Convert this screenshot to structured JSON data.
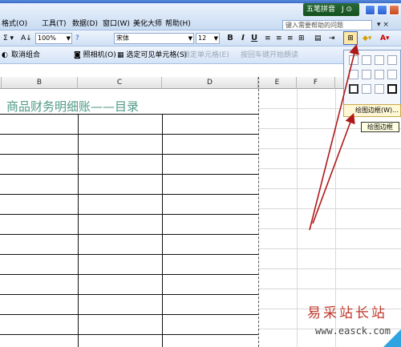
{
  "menubar": {
    "items": [
      "格式(O)",
      "工具(T)",
      "数据(D)",
      "窗口(W)",
      "美化大师",
      "帮助(H)"
    ],
    "help_placeholder": "键入需要帮助的问题",
    "ime_label": "五笔拼音",
    "ime_suffix": "J ⊙"
  },
  "toolbar1": {
    "sum_label": "Σ ▾",
    "sort_label": "A↓",
    "zoom": "100%",
    "help_icon": "?",
    "font_name": "宋体",
    "font_size": "12",
    "bold": "B",
    "italic": "I",
    "underline": "U"
  },
  "toolbar2": {
    "ungroup": "取消组合",
    "camera": "照相机(O)",
    "select_visible": "选定可见单元格(S)",
    "lock_cell": "锁定单元格(E)",
    "enter_from_start": "按回车键开始朗读"
  },
  "sheet": {
    "columns": [
      "B",
      "C",
      "D",
      "E",
      "F"
    ],
    "title_text": "商品财务明细账——目录"
  },
  "border_dropdown": {
    "draw_border_item": "绘图边框(W)...",
    "tooltip": "绘图边框"
  },
  "watermark": {
    "site_name": "易采站长站",
    "url": "www.easck.com"
  },
  "colors": {
    "title_green": "#4f9a86",
    "accent_blue": "#3a6cc8",
    "arrow_red": "#b01818"
  }
}
